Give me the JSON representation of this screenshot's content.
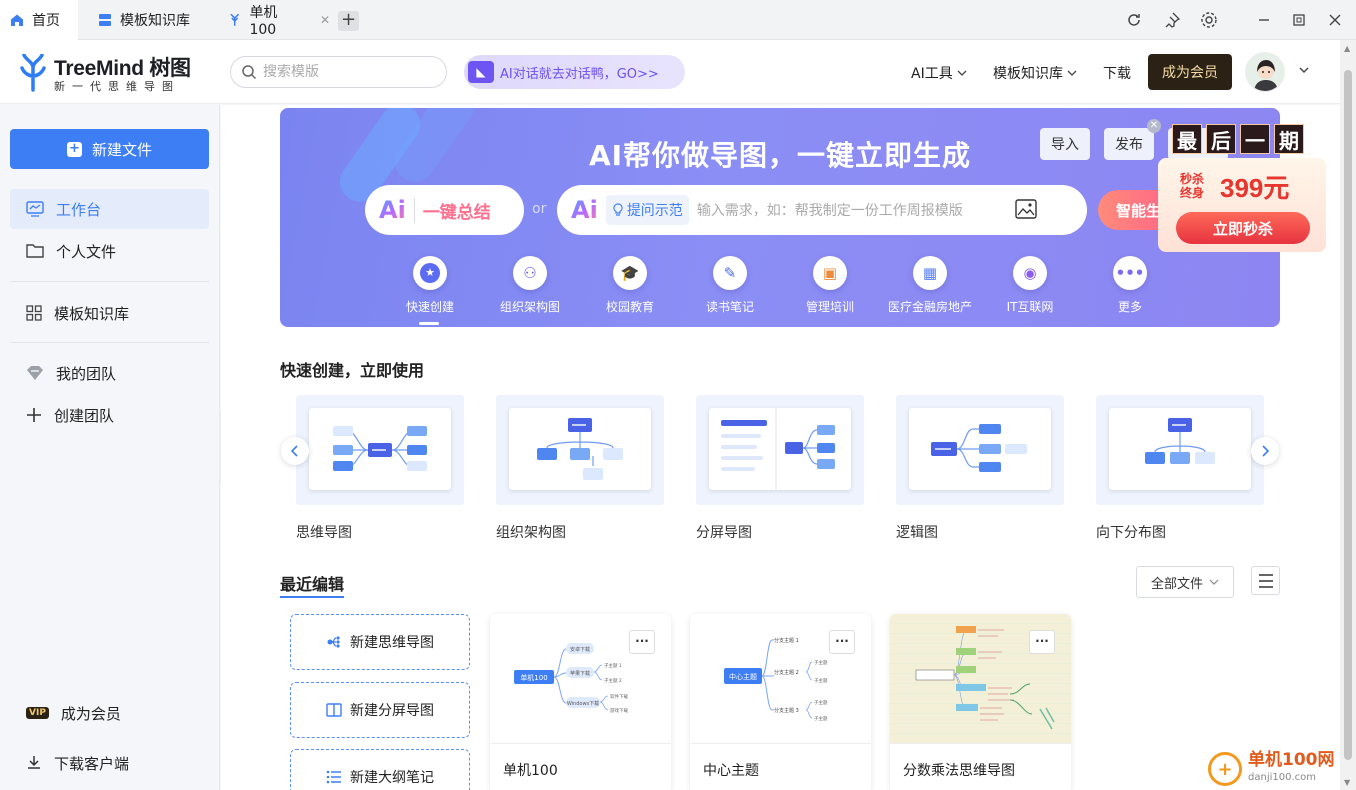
{
  "tabs": [
    {
      "label": "首页",
      "icon": "home-icon"
    },
    {
      "label": "模板知识库",
      "icon": "template-icon"
    },
    {
      "label": "单机100",
      "icon": "treemind-file-icon"
    }
  ],
  "header": {
    "logo_name": "TreeMind 树图",
    "logo_sub": "新一代思维导图",
    "search_placeholder": "搜索模版",
    "ai_promo": "AI对话就去对话鸭，GO>>",
    "nav": {
      "ai_tools": "AI工具",
      "templates": "模板知识库",
      "download": "下载"
    },
    "vip_button": "成为会员"
  },
  "sidebar": {
    "new_file": "新建文件",
    "items": [
      {
        "label": "工作台",
        "icon": "workbench-icon"
      },
      {
        "label": "个人文件",
        "icon": "folder-icon"
      },
      {
        "label": "模板知识库",
        "icon": "grid-icon"
      },
      {
        "label": "我的团队",
        "icon": "team-icon"
      },
      {
        "label": "创建团队",
        "icon": "plus-icon"
      }
    ],
    "vip_badge": "VIP",
    "vip": "成为会员",
    "download": "下载客户端"
  },
  "banner": {
    "title": "AI帮你做导图，一键立即生成",
    "import_btn": "导入",
    "publish_btn": "发布",
    "summary_ai": "Ai",
    "summary": "一键总结",
    "or": "or",
    "input_ai": "Ai",
    "hint_chip": "提问示范",
    "input_placeholder": "输入需求，如：帮我制定一份工作周报模版",
    "smart_btn": "智能生",
    "categories": [
      "快速创建",
      "组织架构图",
      "校园教育",
      "读书笔记",
      "管理培训",
      "医疗金融房地产",
      "IT互联网",
      "更多"
    ]
  },
  "promo": {
    "top": [
      "最",
      "后",
      "一",
      "期"
    ],
    "kill": "秒杀",
    "lifetime": "终身",
    "price": "399元",
    "btn": "立即秒杀"
  },
  "quick": {
    "title": "快速创建，立即使用",
    "templates": [
      "思维导图",
      "组织架构图",
      "分屏导图",
      "逻辑图",
      "向下分布图"
    ]
  },
  "recent": {
    "title": "最近编辑",
    "filter": "全部文件",
    "new_items": [
      "新建思维导图",
      "新建分屏导图",
      "新建大纲笔记"
    ],
    "files": [
      {
        "name": "单机100",
        "center": "单机100",
        "branches": [
          "安卓下载",
          "苹果下载",
          "Windows下载"
        ],
        "subs": [
          "子主题 1",
          "子主题 2",
          "软件下载",
          "游戏下载"
        ]
      },
      {
        "name": "中心主题",
        "center": "中心主题",
        "branches": [
          "分支主题 1",
          "分支主题 2",
          "分支主题 3"
        ],
        "subs": [
          "子主题",
          "子主题",
          "子主题",
          "子主题"
        ]
      },
      {
        "name": "分数乘法思维导图"
      }
    ],
    "more": "···"
  },
  "watermark": {
    "name": "单机100网",
    "url": "danji100.com"
  }
}
